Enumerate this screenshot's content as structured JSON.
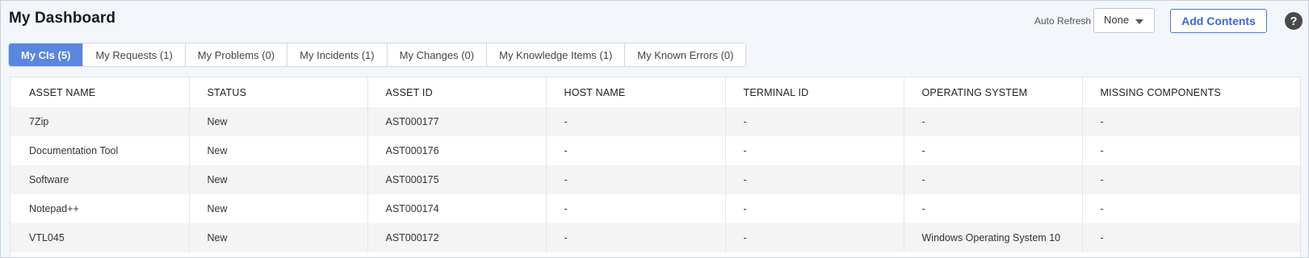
{
  "header": {
    "title": "My Dashboard",
    "auto_refresh_label": "Auto Refresh",
    "auto_refresh_value": "None",
    "add_contents_label": "Add Contents",
    "help_glyph": "?"
  },
  "tabs": [
    {
      "label": "My CIs (5)",
      "active": true
    },
    {
      "label": "My Requests (1)",
      "active": false
    },
    {
      "label": "My Problems (0)",
      "active": false
    },
    {
      "label": "My Incidents (1)",
      "active": false
    },
    {
      "label": "My Changes (0)",
      "active": false
    },
    {
      "label": "My Knowledge Items (1)",
      "active": false
    },
    {
      "label": "My Known Errors (0)",
      "active": false
    }
  ],
  "table": {
    "columns": [
      "ASSET NAME",
      "STATUS",
      "ASSET ID",
      "HOST NAME",
      "TERMINAL ID",
      "OPERATING SYSTEM",
      "MISSING COMPONENTS"
    ],
    "rows": [
      [
        "7Zip",
        "New",
        "AST000177",
        "-",
        "-",
        "-",
        "-"
      ],
      [
        "Documentation Tool",
        "New",
        "AST000176",
        "-",
        "-",
        "-",
        "-"
      ],
      [
        "Software",
        "New",
        "AST000175",
        "-",
        "-",
        "-",
        "-"
      ],
      [
        "Notepad++",
        "New",
        "AST000174",
        "-",
        "-",
        "-",
        "-"
      ],
      [
        "VTL045",
        "New",
        "AST000172",
        "-",
        "-",
        "Windows Operating System 10",
        "-"
      ]
    ]
  },
  "colors": {
    "accent": "#5b86e0",
    "button_text": "#3b67d4",
    "page_bg": "#f3f6fb"
  }
}
